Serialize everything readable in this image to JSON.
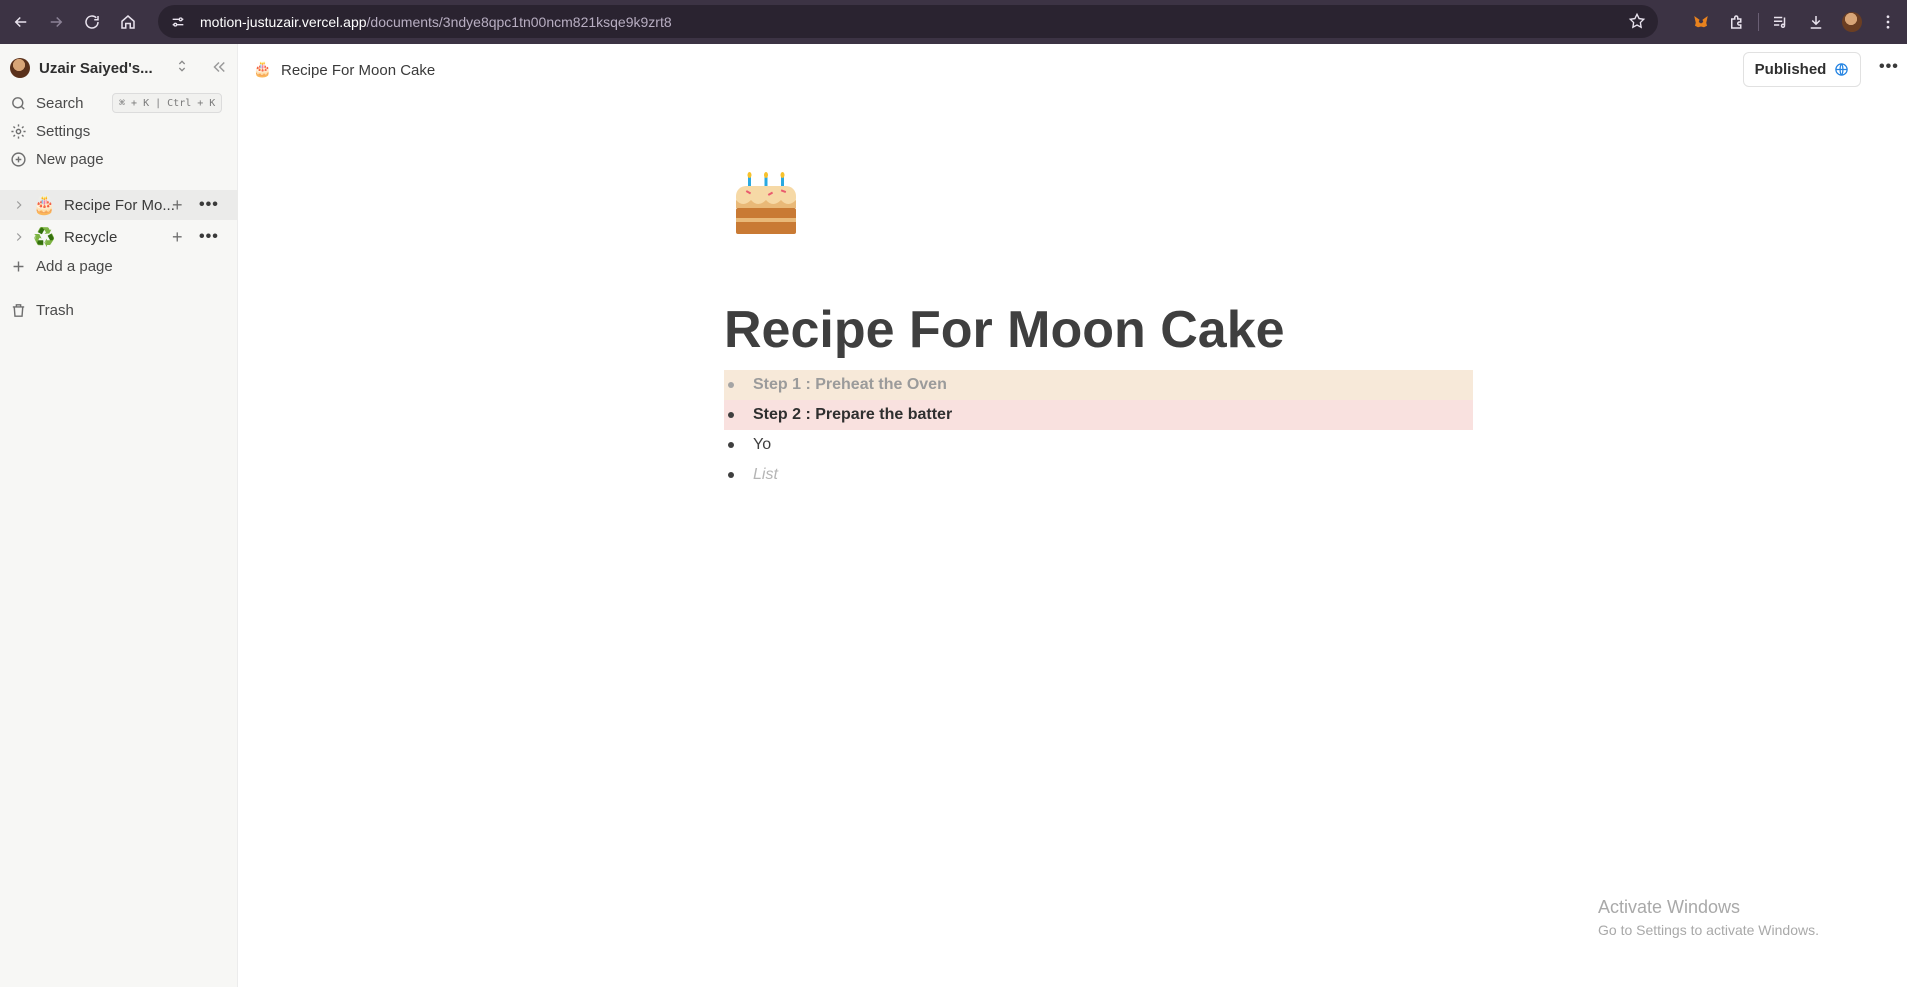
{
  "browser": {
    "url_host": "motion-justuzair.vercel.app",
    "url_path": "/documents/3ndye8qpc1tn00ncm821ksqe9k9zrt8"
  },
  "sidebar": {
    "workspace_name": "Uzair Saiyed's...",
    "search_label": "Search",
    "search_shortcut": "⌘ + K | Ctrl + K",
    "settings_label": "Settings",
    "new_page_label": "New page",
    "pages": [
      {
        "emoji": "🎂",
        "title": "Recipe For Mo...",
        "active": true
      },
      {
        "emoji": "♻️",
        "title": "Recycle",
        "active": false
      }
    ],
    "add_page_label": "Add a page",
    "trash_label": "Trash"
  },
  "topbar": {
    "crumb_emoji": "🎂",
    "crumb_title": "Recipe For Moon Cake",
    "publish_label": "Published"
  },
  "document": {
    "title": "Recipe For Moon Cake",
    "items": [
      {
        "text": "Step 1 : Preheat the Oven",
        "style": "highlight-orange"
      },
      {
        "text": "Step 2 : Prepare the batter",
        "style": "highlight-red"
      },
      {
        "text": "Yo",
        "style": "plain"
      },
      {
        "text": "List",
        "style": "placeholder"
      }
    ]
  },
  "watermark": {
    "line1": "Activate Windows",
    "line2": "Go to Settings to activate Windows."
  },
  "colors": {
    "browser_bar": "#3c3344",
    "sidebar_bg": "#f7f7f5",
    "highlight_orange": "#f7e9d9",
    "highlight_red": "#f9e1df",
    "globe_accent": "#2383e2"
  }
}
